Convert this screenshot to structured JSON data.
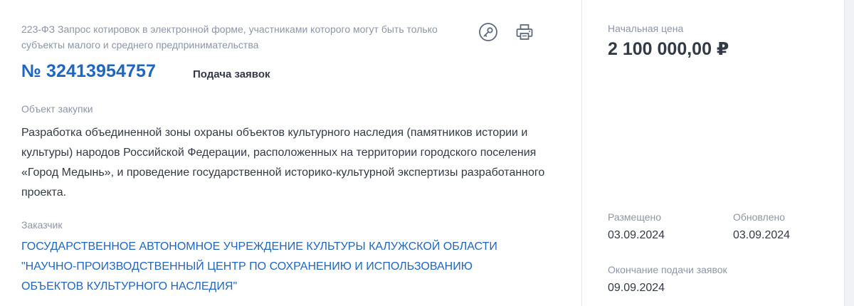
{
  "header": {
    "purchase_type": "223-ФЗ Запрос котировок в электронной форме, участниками которого могут быть только субъекты малого и среднего предпринимательства",
    "number": "№ 32413954757",
    "stage": "Подача заявок",
    "icons": [
      "key-icon",
      "print-icon"
    ]
  },
  "object": {
    "label": "Объект закупки",
    "text": "Разработка объединенной зоны охраны объектов культурного наследия (памятников истории и культуры) народов Российской Федерации, расположенных на территории городского поселения «Город Медынь», и проведение государственной историко-культурной экспертизы разработанного проекта."
  },
  "customer": {
    "label": "Заказчик",
    "name": "ГОСУДАРСТВЕННОЕ АВТОНОМНОЕ УЧРЕЖДЕНИЕ КУЛЬТУРЫ КАЛУЖСКОЙ ОБЛАСТИ \"НАУЧНО-ПРОИЗВОДСТВЕННЫЙ ЦЕНТР ПО СОХРАНЕНИЮ И ИСПОЛЬЗОВАНИЮ ОБЪЕКТОВ КУЛЬТУРНОГО НАСЛЕДИЯ\""
  },
  "price": {
    "label": "Начальная цена",
    "value": "2 100 000,00 ₽"
  },
  "dates": {
    "posted_label": "Размещено",
    "posted_value": "03.09.2024",
    "updated_label": "Обновлено",
    "updated_value": "03.09.2024",
    "deadline_label": "Окончание подачи заявок",
    "deadline_value": "09.09.2024"
  },
  "colors": {
    "accent": "#1f66c1",
    "text": "#333a46",
    "muted": "#8c96a6"
  }
}
